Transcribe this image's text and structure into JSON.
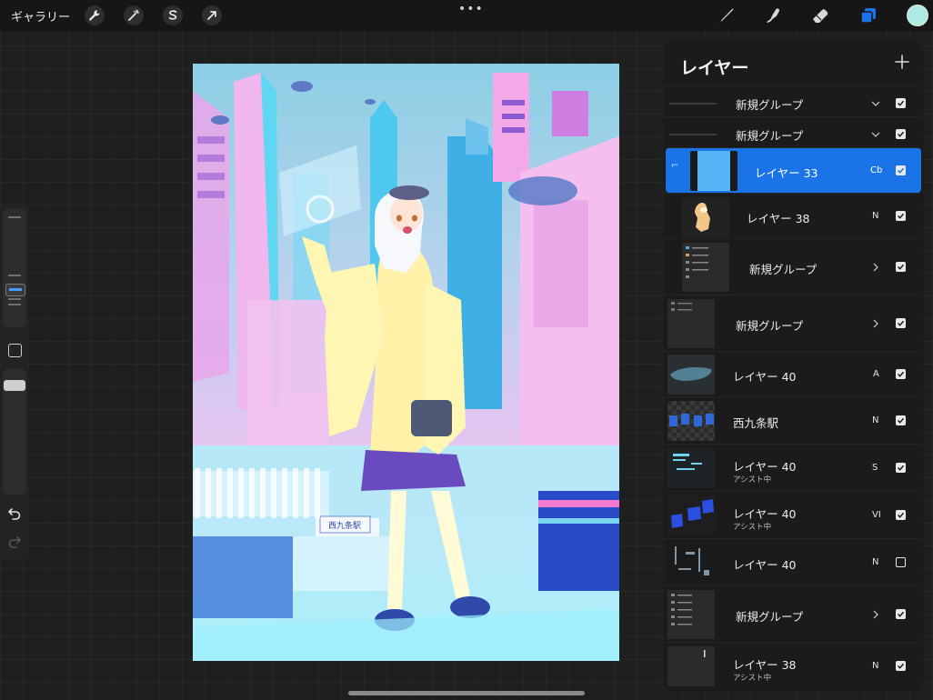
{
  "toolbar": {
    "gallery_label": "ギャラリー",
    "left_tools": [
      {
        "name": "wrench-icon"
      },
      {
        "name": "magic-wand-icon"
      },
      {
        "name": "selection-icon"
      },
      {
        "name": "transform-arrow-icon"
      }
    ],
    "more_label": "•••",
    "right_tools": [
      {
        "name": "brush-icon"
      },
      {
        "name": "smudge-icon"
      },
      {
        "name": "eraser-icon"
      },
      {
        "name": "layers-icon",
        "active": true
      }
    ],
    "current_color": "#aee9e3",
    "accent_color": "#1a74e8"
  },
  "sidebar": {
    "tools": [
      "brush-size-slider",
      "modify-button",
      "opacity-slider",
      "undo-icon",
      "redo-icon"
    ]
  },
  "layers_panel": {
    "title": "レイヤー",
    "add_icon": "plus-icon",
    "layers": [
      {
        "name": "新規グループ",
        "sub": "",
        "mode": "",
        "group": true,
        "expanded": true,
        "visible": true
      },
      {
        "name": "新規グループ",
        "sub": "",
        "mode": "",
        "group": true,
        "expanded": true,
        "visible": true
      },
      {
        "name": "レイヤー 33",
        "sub": "",
        "mode": "Cb",
        "group": false,
        "selected": true,
        "visible": true
      },
      {
        "name": "レイヤー 38",
        "sub": "",
        "mode": "N",
        "group": false,
        "visible": true
      },
      {
        "name": "新規グループ",
        "sub": "",
        "mode": "",
        "group": true,
        "expanded": false,
        "visible": true
      },
      {
        "name": "新規グループ",
        "sub": "",
        "mode": "",
        "group": true,
        "expanded": false,
        "visible": true
      },
      {
        "name": "レイヤー 40",
        "sub": "",
        "mode": "A",
        "group": false,
        "visible": true
      },
      {
        "name": "西九条駅",
        "sub": "",
        "mode": "N",
        "group": false,
        "visible": true
      },
      {
        "name": "レイヤー 40",
        "sub": "アシスト中",
        "mode": "S",
        "group": false,
        "visible": true
      },
      {
        "name": "レイヤー 40",
        "sub": "アシスト中",
        "mode": "VI",
        "group": false,
        "visible": true
      },
      {
        "name": "レイヤー 40",
        "sub": "",
        "mode": "N",
        "group": false,
        "visible": false
      },
      {
        "name": "新規グループ",
        "sub": "",
        "mode": "",
        "group": true,
        "expanded": false,
        "visible": true
      },
      {
        "name": "レイヤー 38",
        "sub": "アシスト中",
        "mode": "N",
        "group": false,
        "visible": true
      }
    ]
  },
  "artwork": {
    "station_sign": "西九条駅"
  }
}
